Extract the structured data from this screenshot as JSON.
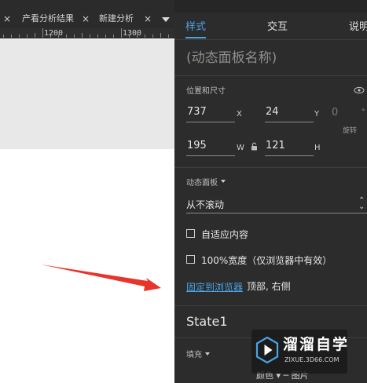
{
  "tabs": [
    {
      "label": "产看分析结果",
      "close": "×"
    },
    {
      "label": "新建分析",
      "close": "×"
    }
  ],
  "first_tab_close": "×",
  "ruler": {
    "labels": [
      "1200",
      "1300"
    ]
  },
  "panel": {
    "tabs": [
      {
        "label": "样式",
        "active": true
      },
      {
        "label": "交互",
        "active": false
      },
      {
        "label": "说明",
        "active": false
      }
    ],
    "name_placeholder": "(动态面板名称)",
    "position_size": {
      "label": "位置和尺寸",
      "x": {
        "value": "737",
        "unit": "X"
      },
      "y": {
        "value": "24",
        "unit": "Y"
      },
      "w": {
        "value": "195",
        "unit": "W"
      },
      "h": {
        "value": "121",
        "unit": "H"
      },
      "rotation": {
        "value": "0",
        "label": "旋转",
        "unit": "°"
      }
    },
    "dynamic_panel": {
      "label": "动态面板",
      "scroll_option": "从不滚动",
      "scroll_arrows": "⌃\n⌄"
    },
    "checkboxes": [
      {
        "label": "自适应内容",
        "checked": false
      },
      {
        "label": "100%宽度（仅浏览器中有效）",
        "checked": false
      }
    ],
    "pin": {
      "link": "固定到浏览器",
      "value": "顶部, 右侧"
    },
    "state": {
      "name": "State1"
    },
    "fill": {
      "label": "填充"
    },
    "bottom_cut_text": "颜色 ▾   ─  图片"
  },
  "watermark": {
    "title": "溜溜自学",
    "url": "ZIXUE.3D66.COM"
  },
  "colors": {
    "accent": "#4aa3e6",
    "arrow": "#e8352b",
    "panel_bg": "#2c2c2c"
  }
}
